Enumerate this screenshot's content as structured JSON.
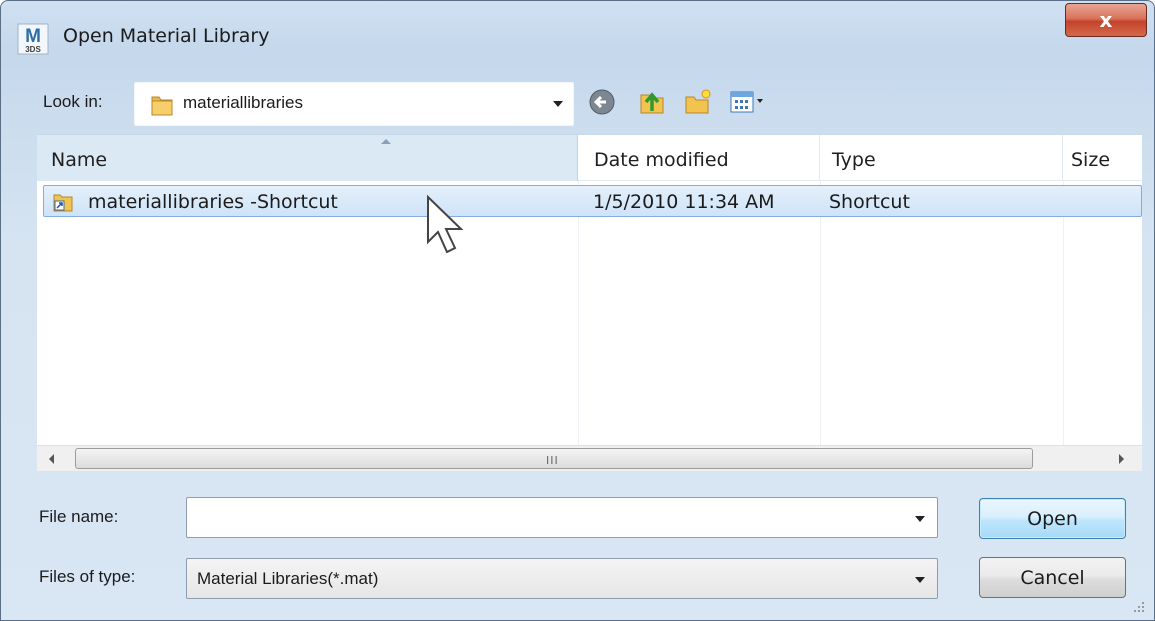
{
  "window": {
    "title": "Open Material Library",
    "close_glyph": "x"
  },
  "app_icon": {
    "name": "3ds-max-icon",
    "letters": "M",
    "sub": "3DS"
  },
  "lookin": {
    "label": "Look in:",
    "value": "materiallibraries",
    "icon": "folder-icon"
  },
  "toolbar": {
    "icons": [
      "back-icon",
      "up-folder-icon",
      "new-folder-icon",
      "view-menu-icon"
    ]
  },
  "list": {
    "columns": [
      "Name",
      "Date modified",
      "Type",
      "Size"
    ],
    "rows": [
      {
        "name": "materiallibraries -Shortcut",
        "date": "1/5/2010 11:34 AM",
        "type": "Shortcut",
        "size": "",
        "selected": true
      }
    ]
  },
  "scrollbar": {
    "grip": "III"
  },
  "footer": {
    "filename_label": "File name:",
    "filename_value": "",
    "filetype_label": "Files of type:",
    "filetype_value": "Material Libraries(*.mat)",
    "open_label": "Open",
    "cancel_label": "Cancel"
  },
  "colors": {
    "selection": "#cfe3f7",
    "selection_border": "#84acdd",
    "close_button": "#c4432a",
    "default_button": "#bee6fd"
  }
}
